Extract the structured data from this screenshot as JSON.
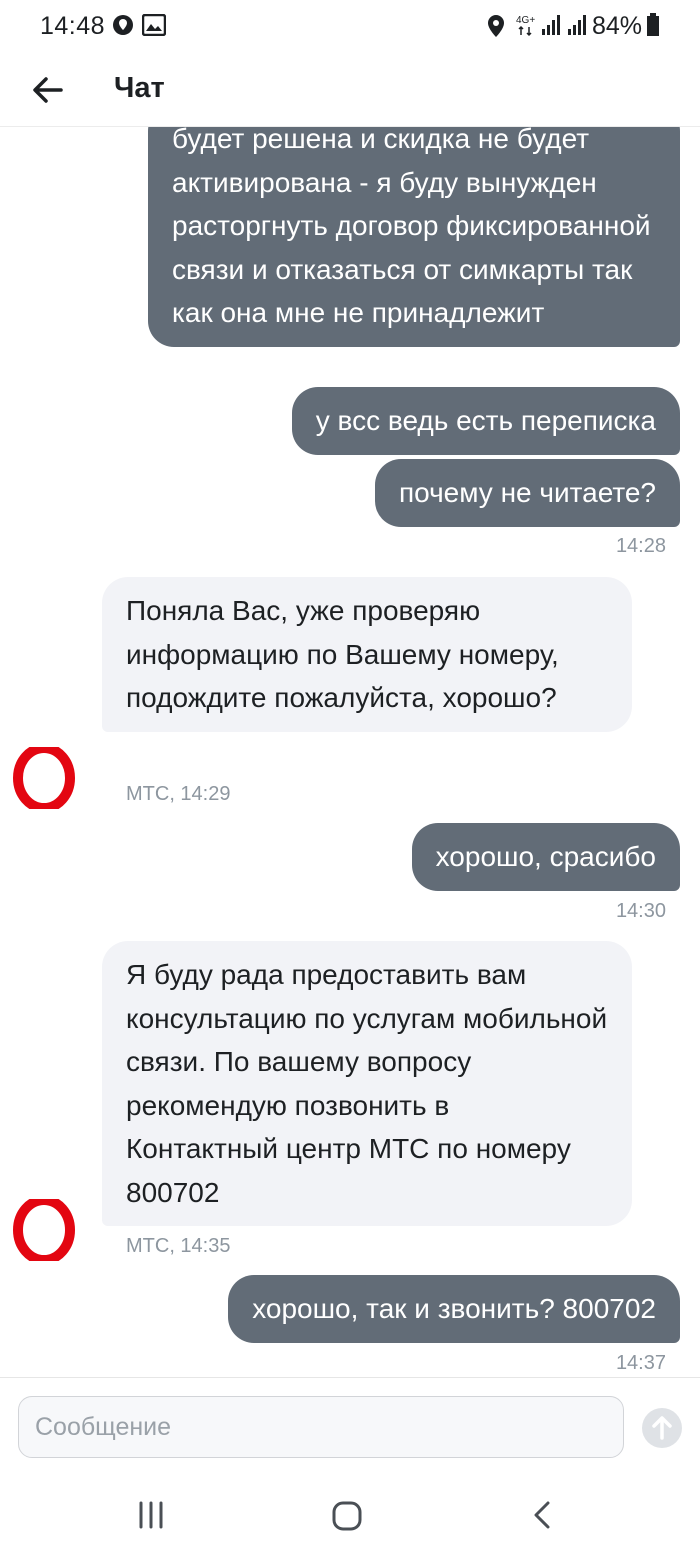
{
  "status_bar": {
    "time": "14:48",
    "network": "4G+",
    "battery": "84%"
  },
  "header": {
    "title": "Чат",
    "back_icon": "arrow-left-icon"
  },
  "messages": [
    {
      "side": "out",
      "text": "будет решена и скидка не будет активирована - я буду вынужден расторгнуть договор фиксированной связи и отказаться от симкарты так как она мне не принадлежит"
    },
    {
      "side": "out",
      "text": "у всс ведь есть переписка"
    },
    {
      "side": "out",
      "text": "почему не читаете?",
      "time": "14:28"
    },
    {
      "side": "in",
      "text": "Поняла Вас, уже проверяю информацию по Вашему номеру, подождите пожалуйста, хорошо?",
      "meta": "МТС, 14:29"
    },
    {
      "side": "out",
      "text": "хорошо, срасибо",
      "time": "14:30"
    },
    {
      "side": "in",
      "text": "Я буду рада предоставить вам консультацию по услугам мобильной связи. По вашему вопросу рекомендую позвонить в Контактный центр МТС по номеру 800702",
      "meta": "МТС, 14:35"
    },
    {
      "side": "out",
      "text": "хорошо, так и звонить? 800702",
      "time": "14:37"
    }
  ],
  "composer": {
    "placeholder": "Сообщение",
    "value": "",
    "send_icon": "arrow-up-icon"
  },
  "colors": {
    "outgoing_bubble": "#626c77",
    "incoming_bubble": "#f2f3f7",
    "brand_red": "#e30611"
  }
}
